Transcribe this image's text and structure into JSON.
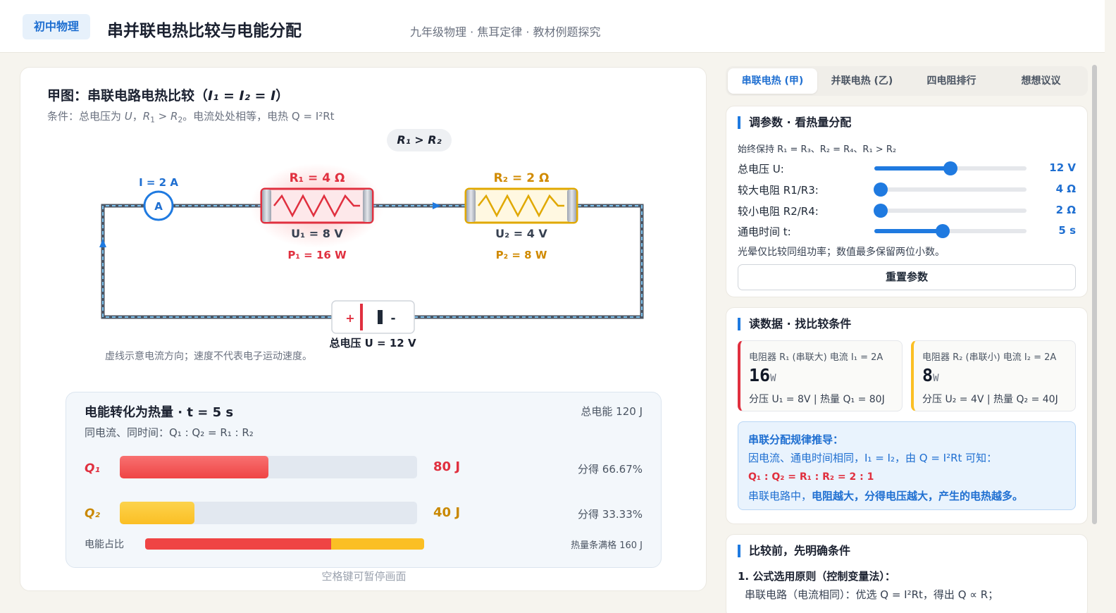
{
  "header": {
    "badge": "初中物理",
    "title": "串并联电热比较与电能分配",
    "subtitle": "九年级物理 · 焦耳定律 · 教材例题探究"
  },
  "left": {
    "title_text": "甲图：串联电路电热比较（",
    "title_formula": "I₁ = I₂ = I",
    "title_end": "）",
    "condition_a": "条件：总电压为 ",
    "condition_b": "。电流处处相等，电热 Q = I²Rt",
    "tag": "R₁ > R₂",
    "ammeter_label": "I = 2 A",
    "ammeter_symbol": "A",
    "r1": {
      "label": "R₁ = 4 Ω",
      "voltage": "U₁ = 8 V",
      "power": "P₁ = 16 W"
    },
    "r2": {
      "label": "R₂ = 2 Ω",
      "voltage": "U₂ = 4 V",
      "power": "P₂ = 8 W"
    },
    "battery_plus": "+",
    "battery_minus": "-",
    "battery_label": "总电压 U = 12 V",
    "note": "虚线示意电流方向；速度不代表电子运动速度。",
    "energy": {
      "title": "电能转化为热量 · t = 5 s",
      "total": "总电能 120 J",
      "subtitle": "同电流、同时间：Q₁ : Q₂ = R₁ : R₂",
      "q1_label": "Q₁",
      "q1_value": "80 J",
      "q1_share": "分得 66.67%",
      "q1_fill": 0.5,
      "q2_label": "Q₂",
      "q2_value": "40 J",
      "q2_share": "分得 33.33%",
      "q2_fill": 0.25,
      "ratio_label": "电能占比",
      "ratio_q1": 0.6667,
      "ratio_note": "热量条满格 160 J"
    },
    "space_hint": "空格键可暂停画面"
  },
  "tabs": [
    "串联电热 (甲)",
    "并联电热 (乙)",
    "四电阻排行",
    "想想议议"
  ],
  "params": {
    "title": "调参数 · 看热量分配",
    "hint": "始终保持 R₁ = R₃、R₂ = R₄、R₁ > R₂",
    "items": [
      {
        "label": "总电压 U:",
        "value": "12  V",
        "fill": 0.5
      },
      {
        "label": "较大电阻 R1/R3:",
        "value": "4  Ω",
        "fill": 0.04
      },
      {
        "label": "较小电阻 R2/R4:",
        "value": "2  Ω",
        "fill": 0.04
      },
      {
        "label": "通电时间 t:",
        "value": "5  s",
        "fill": 0.45
      }
    ],
    "note": "光晕仅比较同组功率；数值最多保留两位小数。",
    "reset": "重置参数"
  },
  "readout": {
    "title": "读数据 · 找比较条件",
    "box1": {
      "head": "电阻器 R₁ (串联大)   电流 I₁ = 2A",
      "big": "16",
      "unit": "W",
      "foot": "分压 U₁ = 8V | 热量 Q₁ = 80J"
    },
    "box2": {
      "head": "电阻器 R₂ (串联小)   电流 I₂ = 2A",
      "big": "8",
      "unit": "W",
      "foot": "分压 U₂ = 4V | 热量 Q₂ = 40J"
    },
    "derive_title": "串联分配规律推导：",
    "derive_line": "因电流、通电时间相同，I₁ = I₂，由 Q = I²Rt 可知：",
    "derive_formula": "Q₁ : Q₂ = R₁ : R₂ = 2 : 1",
    "derive_concl_a": "串联电路中，",
    "derive_concl_b": "电阻越大，分得电压越大，产生的电热越多。"
  },
  "compare": {
    "title": "比较前，先明确条件",
    "line1": "1. 公式选用原则（控制变量法）：",
    "line2": "串联电路（电流相同）：优选 Q = I²Rt，得出 Q ∝ R；"
  },
  "colors": {
    "accent": "#1f7ae0",
    "r1": "#e0303f",
    "r2": "#e0a800",
    "r2_text": "#d08a00"
  }
}
